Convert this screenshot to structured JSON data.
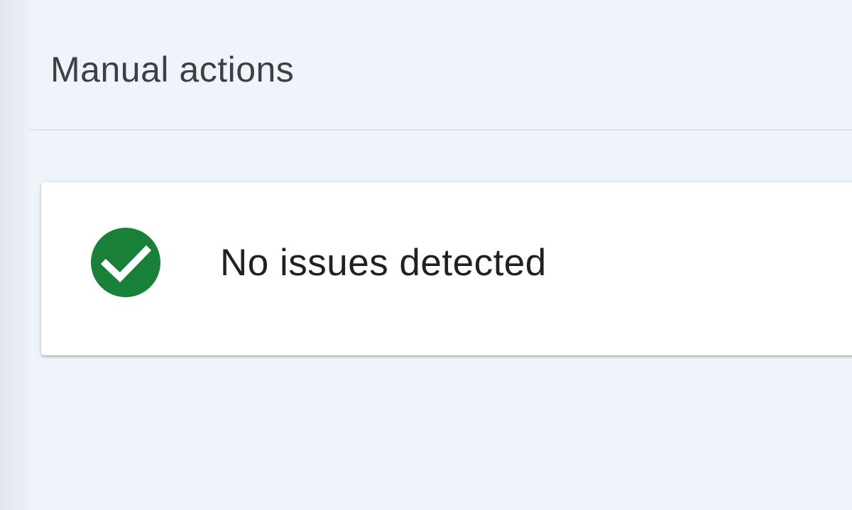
{
  "page": {
    "title": "Manual actions"
  },
  "status_card": {
    "icon": "check-circle-icon",
    "icon_color": "#188038",
    "message": "No issues detected"
  },
  "colors": {
    "background": "#eff3fa",
    "card": "#ffffff",
    "title_text": "#3c4043",
    "body_text": "#202124"
  }
}
